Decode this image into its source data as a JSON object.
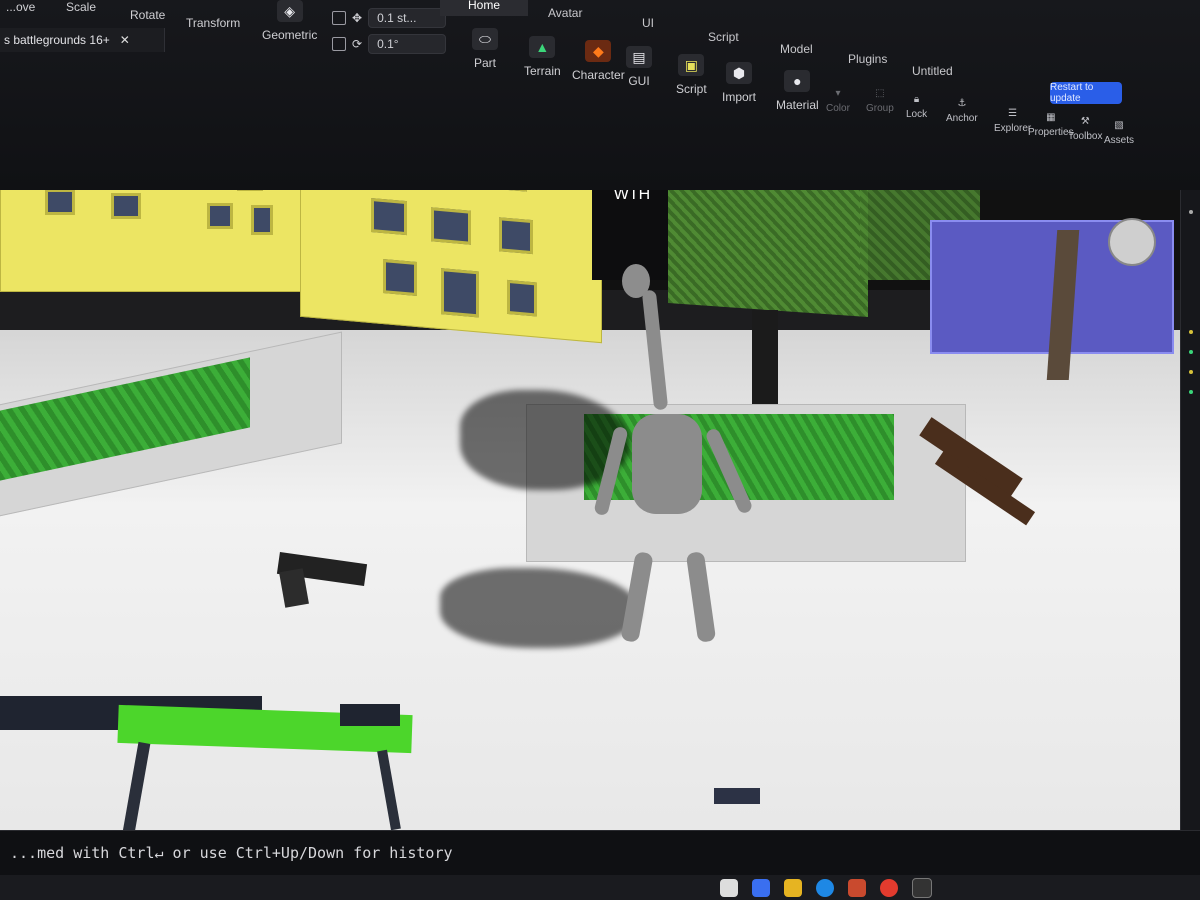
{
  "toolbar": {
    "left_tools": [
      "Scale",
      "Rotate",
      "Transform"
    ],
    "partial_left_tool": "...ove",
    "geometric_label": "Geometric",
    "move_snap_value": "0.1 st...",
    "rotate_snap_value": "0.1°"
  },
  "menu_tabs": [
    "Home",
    "Avatar",
    "UI",
    "Script",
    "Model",
    "Plugins",
    "Untitled"
  ],
  "active_tab": "Home",
  "insert_tools": [
    "Part",
    "Terrain",
    "Character",
    "GUI",
    "Script",
    "Import",
    "Material"
  ],
  "edit_tools": {
    "color": "Color",
    "group": "Group",
    "lock": "Lock",
    "anchor": "Anchor"
  },
  "panel_tools": [
    "Explorer",
    "Properties",
    "Toolbox",
    "Assets"
  ],
  "update_button": "Restart to update",
  "document_tab": {
    "title": "s battlegrounds 16+",
    "close": "✕"
  },
  "viewport": {
    "sign_text": "WTH"
  },
  "command_bar": {
    "text": "...med with Ctrl↵ or use Ctrl+Up/Down for history"
  },
  "colors": {
    "accent": "#ff7a1a",
    "update_button": "#2a5ee8",
    "building_yellow": "#ece563",
    "blue_building": "#5b5ac2",
    "gun_green": "#4cd62b"
  }
}
